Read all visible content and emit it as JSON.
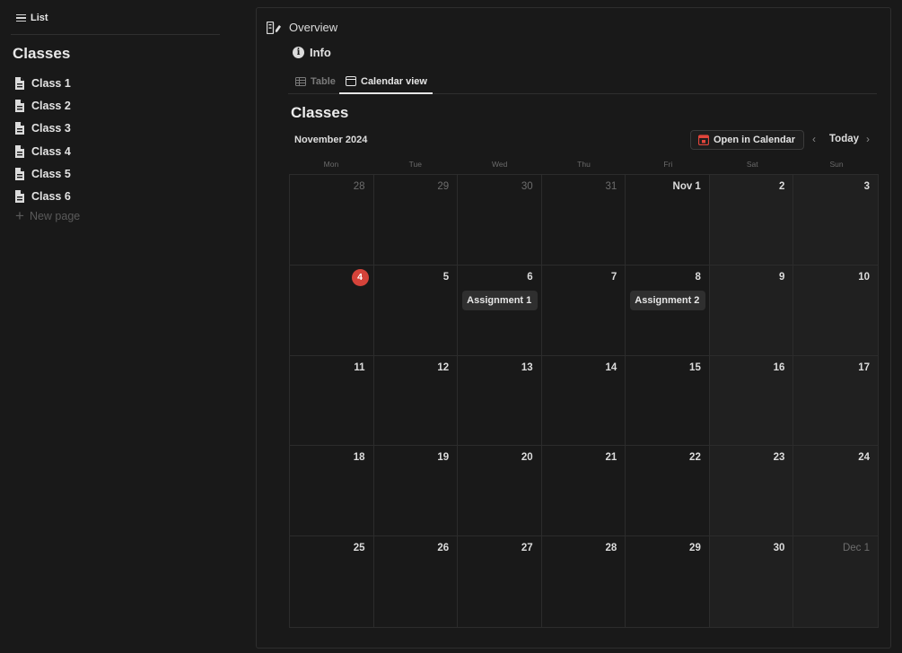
{
  "sidebar": {
    "view_tab": "List",
    "title": "Classes",
    "items": [
      {
        "label": "Class 1"
      },
      {
        "label": "Class 2"
      },
      {
        "label": "Class 3"
      },
      {
        "label": "Class 4"
      },
      {
        "label": "Class 5"
      },
      {
        "label": "Class 6"
      }
    ],
    "new_page": "New page"
  },
  "main": {
    "overview": "Overview",
    "info": "Info",
    "tabs": [
      {
        "label": "Table",
        "icon": "table-icon"
      },
      {
        "label": "Calendar view",
        "icon": "calendar-icon",
        "active": true
      }
    ],
    "title": "Classes",
    "month_label": "November 2024",
    "open_in_calendar": "Open in Calendar",
    "today": "Today",
    "weekdays": [
      "Mon",
      "Tue",
      "Wed",
      "Thu",
      "Fri",
      "Sat",
      "Sun"
    ],
    "days": [
      {
        "label": "28",
        "outside": true
      },
      {
        "label": "29",
        "outside": true
      },
      {
        "label": "30",
        "outside": true
      },
      {
        "label": "31",
        "outside": true
      },
      {
        "label": "Nov 1"
      },
      {
        "label": "2"
      },
      {
        "label": "3"
      },
      {
        "label": "4",
        "today": true
      },
      {
        "label": "5"
      },
      {
        "label": "6",
        "event": "Assignment 1"
      },
      {
        "label": "7"
      },
      {
        "label": "8",
        "event": "Assignment 2"
      },
      {
        "label": "9"
      },
      {
        "label": "10"
      },
      {
        "label": "11"
      },
      {
        "label": "12"
      },
      {
        "label": "13"
      },
      {
        "label": "14"
      },
      {
        "label": "15"
      },
      {
        "label": "16"
      },
      {
        "label": "17"
      },
      {
        "label": "18"
      },
      {
        "label": "19"
      },
      {
        "label": "20"
      },
      {
        "label": "21"
      },
      {
        "label": "22"
      },
      {
        "label": "23"
      },
      {
        "label": "24"
      },
      {
        "label": "25"
      },
      {
        "label": "26"
      },
      {
        "label": "27"
      },
      {
        "label": "28"
      },
      {
        "label": "29"
      },
      {
        "label": "30"
      },
      {
        "label": "Dec 1",
        "outside": true
      }
    ]
  },
  "colors": {
    "background": "#191919",
    "today_marker": "#d5433a",
    "event_chip": "#2f2f2f",
    "calendar_icon": "#e0453b"
  }
}
